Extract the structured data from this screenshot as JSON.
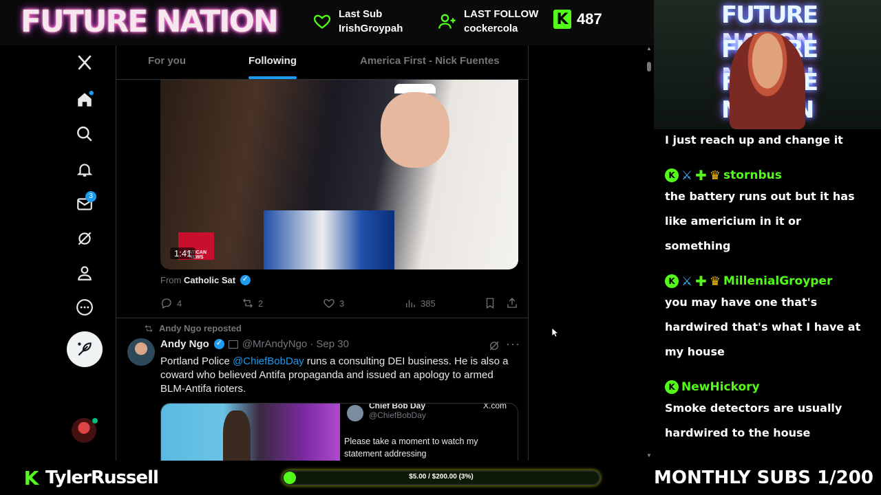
{
  "overlay": {
    "logo": "FUTURE NATION",
    "last_sub": {
      "label": "Last Sub",
      "name": "IrishGroypah"
    },
    "last_follow": {
      "label": "LAST FOLLOW",
      "name": "cockercola"
    },
    "kick_badge": "K",
    "kick_count": "487",
    "channel_name": "TylerRussell",
    "sub_goal": {
      "label": "$5.00 / $200.00 (3%)",
      "progress": 0.03
    },
    "monthly_subs": "MONTHLY SUBS 1/200",
    "cam_text": [
      "FUTURE NATION",
      "FUTURE NATION",
      "FUTURE NATION"
    ]
  },
  "nav": {
    "items": [
      "x-logo",
      "home-icon",
      "search-icon",
      "bell-icon",
      "mail-icon",
      "grok-icon",
      "profile-icon",
      "more-icon"
    ],
    "mail_badge": "3"
  },
  "tabs": [
    {
      "label": "For you",
      "active": false
    },
    {
      "label": "Following",
      "active": true
    },
    {
      "label": "America First - Nick Fuentes",
      "active": false
    }
  ],
  "post1": {
    "video_duration": "1:41",
    "video_logo": "VATICAN NEWS",
    "from_prefix": "From",
    "from_source": "Catholic Sat",
    "replies": "4",
    "reposts": "2",
    "likes": "3",
    "views": "385"
  },
  "post2": {
    "repost_label": "Andy Ngo reposted",
    "author": "Andy Ngo",
    "handle": "@MrAndyNgo",
    "date": "· Sep 30",
    "body_pre": "Portland Police ",
    "mention": "@ChiefBobDay",
    "body_post": " runs a consulting DEI business. He is also a coward who believed Antifa propaganda and issued an apology to armed BLM-Antifa rioters.",
    "card_name": "Chief Bob Day",
    "card_handle": "@ChiefBobDay",
    "card_source": "X.com",
    "card_text": "Please take a moment to watch my statement addressing"
  },
  "chat": {
    "messages": [
      {
        "user": "",
        "text": "I just reach up and change it"
      },
      {
        "user": "stornbus",
        "badges": [
          "kick",
          "sword",
          "plus",
          "crown"
        ],
        "text": "the battery runs out but it has like americium in it or something"
      },
      {
        "user": "MillenialGroyper",
        "badges": [
          "kick",
          "sword",
          "plus",
          "crown"
        ],
        "text": "you may have one that's hardwired that's what I have at my house"
      },
      {
        "user": "NewHickory",
        "badges": [
          "kick"
        ],
        "text": "Smoke detectors are usually hardwired to the house"
      }
    ]
  },
  "colors": {
    "kick_green": "#53fc18",
    "x_blue": "#1d9bf0",
    "background": "#000000"
  }
}
